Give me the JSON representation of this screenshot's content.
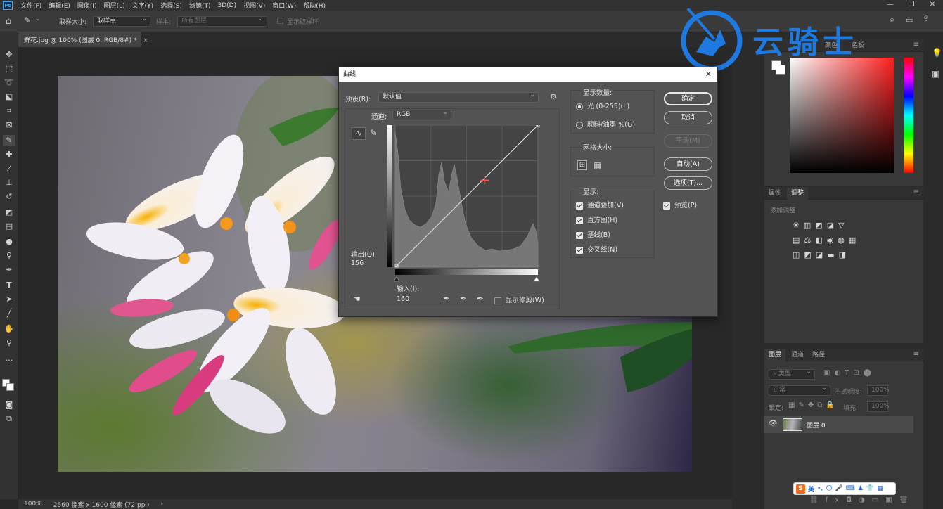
{
  "menubar": {
    "app_icon": "Ps",
    "items": [
      "文件(F)",
      "编辑(E)",
      "图像(I)",
      "图层(L)",
      "文字(Y)",
      "选择(S)",
      "滤镜(T)",
      "3D(D)",
      "视图(V)",
      "窗口(W)",
      "帮助(H)"
    ]
  },
  "options_bar": {
    "sample_size_label": "取样大小:",
    "sample_size_value": "取样点",
    "sample_label": "样本:",
    "sample_value": "所有图层",
    "show_ring_label": "显示取样环"
  },
  "document_tab": {
    "title": "鲜花.jpg @ 100% (图层 0, RGB/8#) *",
    "close": "×"
  },
  "status_bar": {
    "zoom": "100%",
    "doc_info": "2560 像素 x 1600 像素 (72 ppi)",
    "arrow": "›"
  },
  "curves_dialog": {
    "title": "曲线",
    "preset_label": "预设(R):",
    "preset_value": "默认值",
    "channel_label": "通道:",
    "channel_value": "RGB",
    "output_label": "输出(O):",
    "output_value": "156",
    "input_label": "输入(I):",
    "input_value": "160",
    "show_clipping_label": "显示修剪(W)",
    "show_amount_title": "显示数量:",
    "light_option": "光 (0-255)(L)",
    "pigment_option": "颜料/油墨 %(G)",
    "grid_size_title": "网格大小:",
    "display_title": "显示:",
    "display_options": [
      "通道叠加(V)",
      "直方图(H)",
      "基线(B)",
      "交叉线(N)"
    ],
    "buttons": {
      "ok": "确定",
      "cancel": "取消",
      "smooth": "平滑(M)",
      "auto": "自动(A)",
      "options": "选项(T)..."
    },
    "preview_label": "预览(P)",
    "curve_point": {
      "input": 160,
      "output": 156
    }
  },
  "color_panel": {
    "tabs": [
      "颜色",
      "色板"
    ]
  },
  "adjustments_panel": {
    "tabs": [
      "属性",
      "调整"
    ],
    "add_label": "添加调整"
  },
  "layers_panel": {
    "tabs": [
      "图层",
      "通道",
      "路径"
    ],
    "filter_kind": "类型",
    "blend_mode": "正常",
    "opacity_label": "不透明度:",
    "opacity_value": "100%",
    "lock_label": "锁定:",
    "fill_label": "填充:",
    "fill_value": "100%",
    "layer_name": "图层 0"
  },
  "watermark": {
    "text": "云骑士"
  },
  "ime": {
    "logo": "S",
    "mode": "英"
  },
  "colors": {
    "accent": "#31a8ff",
    "watermark_blue": "#1e7ae0"
  }
}
